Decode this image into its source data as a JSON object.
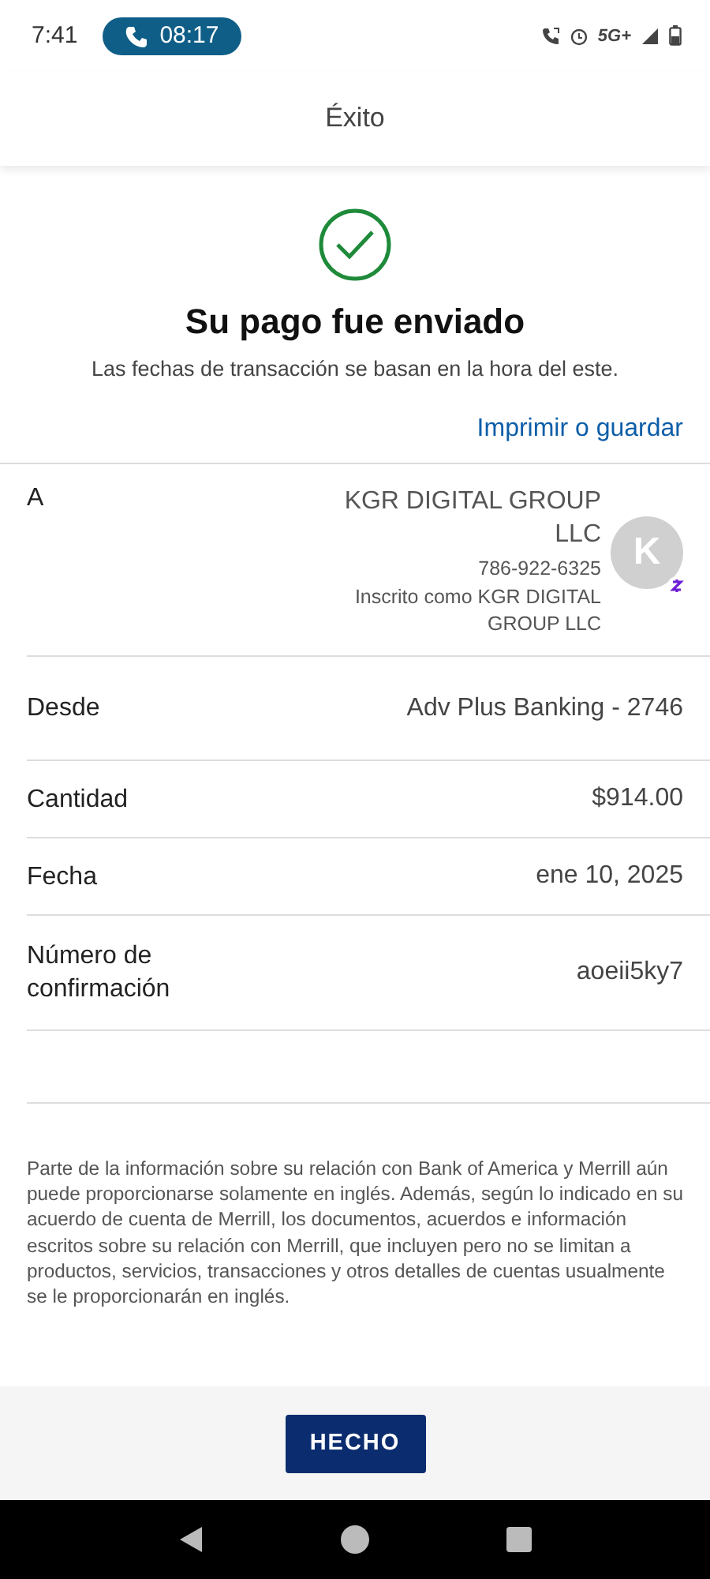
{
  "status_bar": {
    "time": "7:41",
    "call_timer": "08:17",
    "network": "5G+"
  },
  "header": {
    "title": "Éxito"
  },
  "confirmation": {
    "title": "Su pago fue enviado",
    "subtitle": "Las fechas de transacción se basan en la hora del este.",
    "link": "Imprimir o guardar"
  },
  "details": [
    {
      "kind": "recipient",
      "label": "A",
      "name": "KGR DIGITAL GROUP LLC",
      "phone": "786-922-6325",
      "enrolled": "Inscrito como KGR DIGITAL GROUP LLC",
      "avatar_letter": "K"
    },
    {
      "kind": "simple",
      "label": "Desde",
      "value": "Adv Plus Banking - 2746"
    },
    {
      "kind": "simple",
      "label": "Cantidad",
      "value": "$914.00"
    },
    {
      "kind": "simple",
      "label": "Fecha",
      "value": "ene 10, 2025"
    },
    {
      "kind": "simple",
      "label": "Número de confirmación",
      "value": "aoeii5ky7"
    }
  ],
  "disclaimer": "Parte de la información sobre su relación con Bank of America y Merrill aún puede proporcionarse solamente en inglés. Además, según lo indicado en su acuerdo de cuenta de Merrill, los documentos, acuerdos e información escritos sobre su relación con Merrill, que incluyen pero no se limitan a productos, servicios, transacciones y otros detalles de cuentas usualmente se le proporcionarán en inglés.",
  "done_button": "HECHO"
}
